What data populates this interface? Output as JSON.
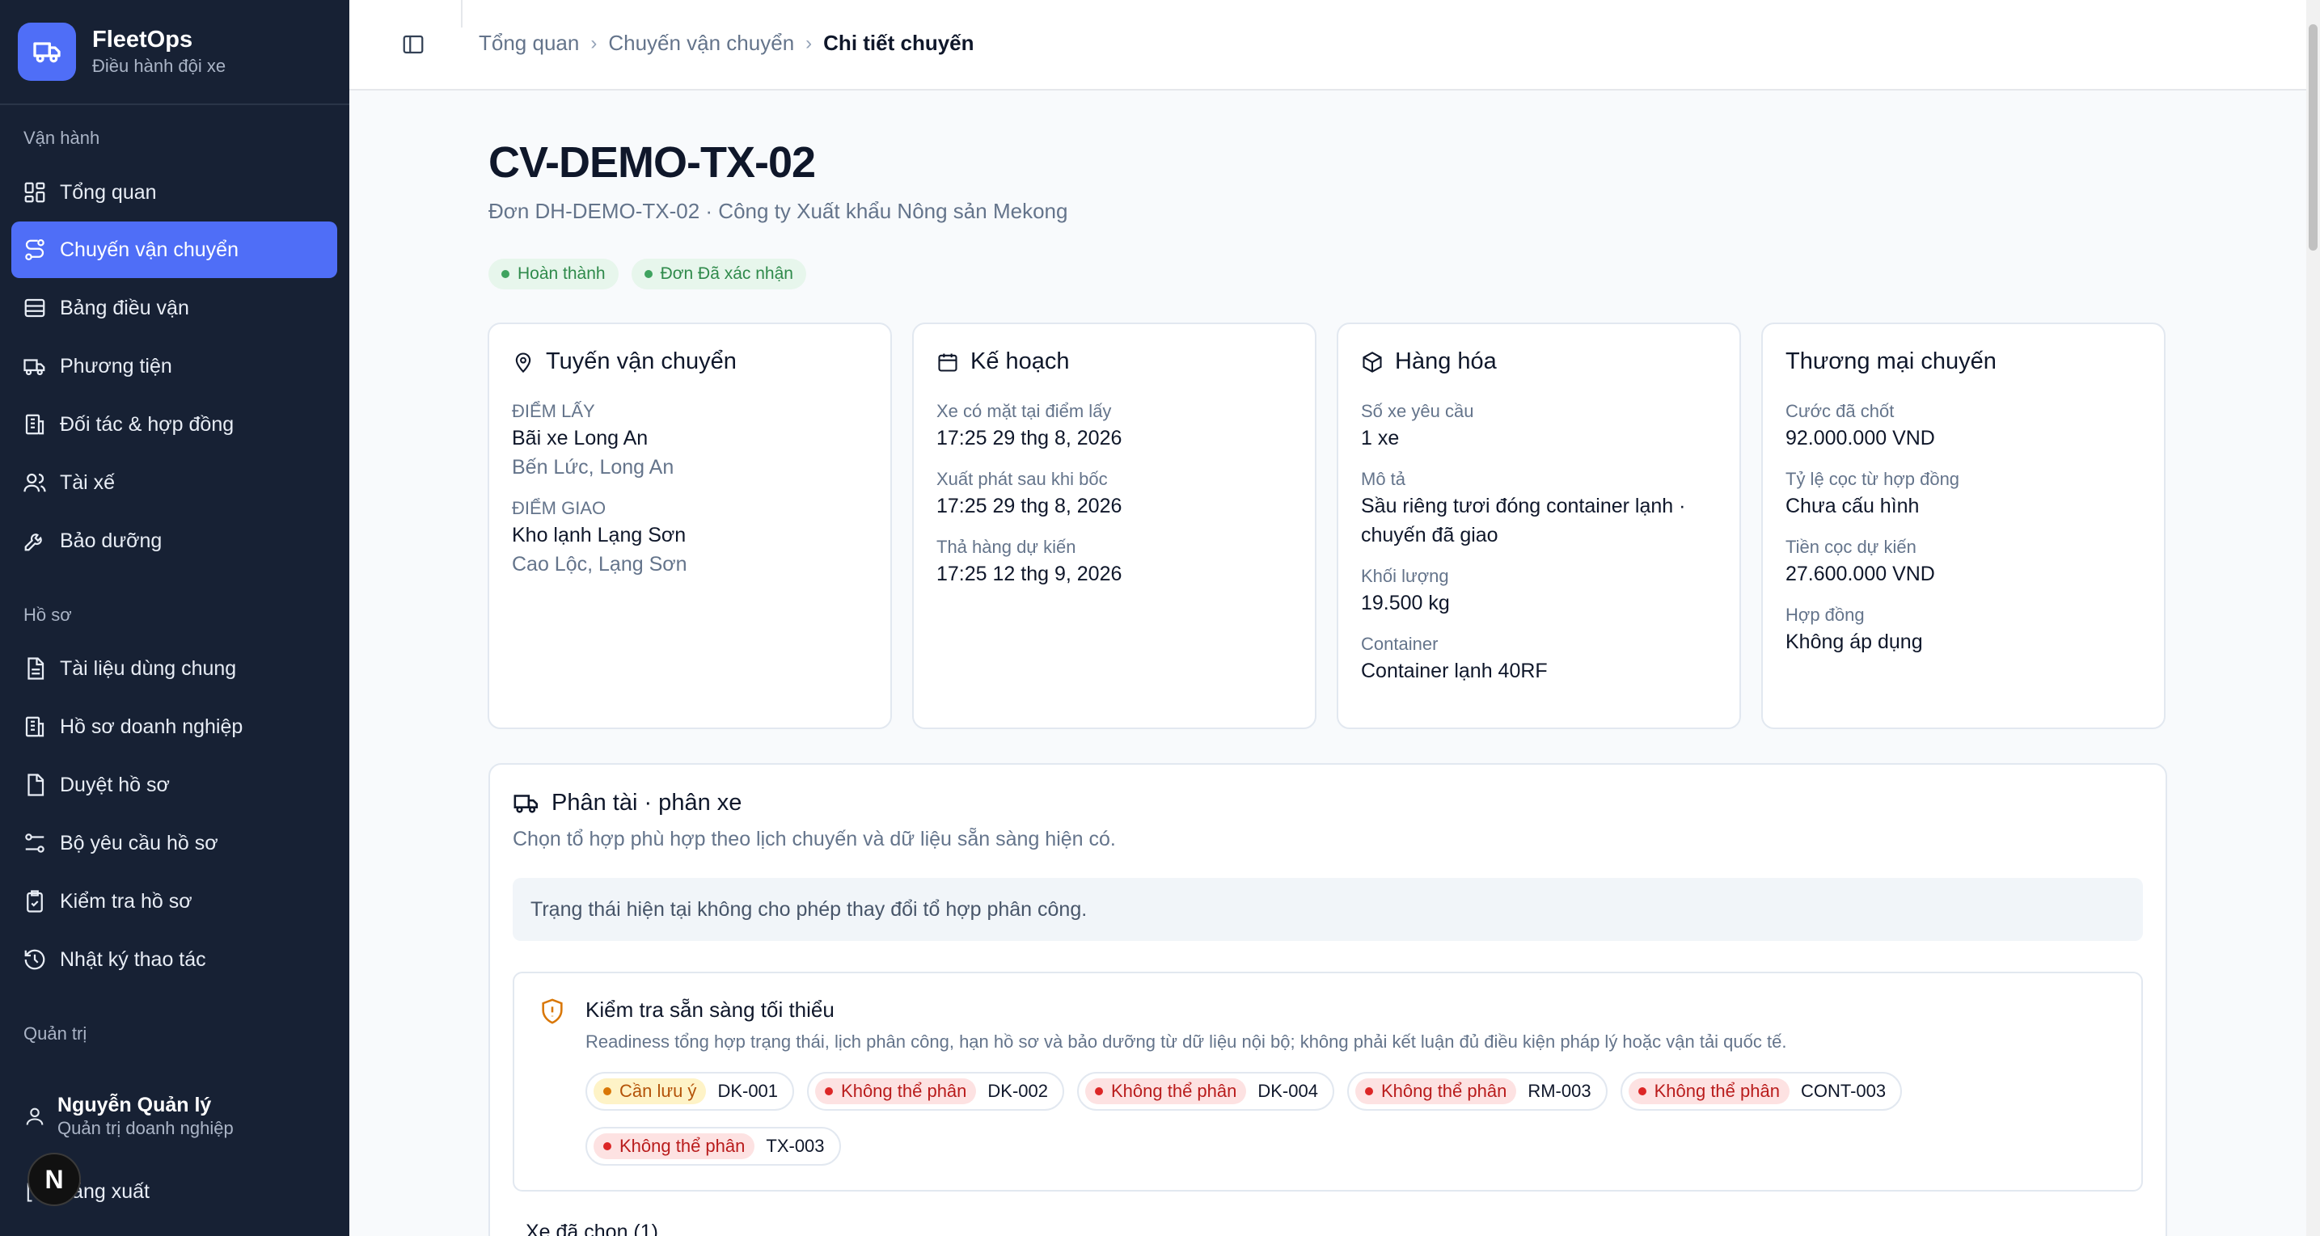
{
  "brand": {
    "title": "FleetOps",
    "subtitle": "Điều hành đội xe"
  },
  "sidebar": {
    "sections": [
      "Vận hành",
      "Hồ sơ",
      "Quản trị"
    ],
    "items": [
      {
        "label": "Tổng quan",
        "icon": "dashboard-icon"
      },
      {
        "label": "Chuyến vận chuyển",
        "icon": "route-icon",
        "active": true
      },
      {
        "label": "Bảng điều vận",
        "icon": "table-icon"
      },
      {
        "label": "Phương tiện",
        "icon": "truck-icon"
      },
      {
        "label": "Đối tác & hợp đồng",
        "icon": "building-icon"
      },
      {
        "label": "Tài xế",
        "icon": "users-icon"
      },
      {
        "label": "Bảo dưỡng",
        "icon": "wrench-icon"
      },
      {
        "label": "Tài liệu dùng chung",
        "icon": "document-icon"
      },
      {
        "label": "Hồ sơ doanh nghiệp",
        "icon": "building-icon"
      },
      {
        "label": "Duyệt hồ sơ",
        "icon": "file-check-icon"
      },
      {
        "label": "Bộ yêu cầu hồ sơ",
        "icon": "sliders-icon"
      },
      {
        "label": "Kiểm tra hồ sơ",
        "icon": "clipboard-check-icon"
      },
      {
        "label": "Nhật ký thao tác",
        "icon": "history-icon"
      }
    ],
    "user": {
      "name": "Nguyễn Quản lý",
      "role": "Quản trị doanh nghiệp"
    },
    "logout": "Đăng xuất",
    "dev_badge": "N"
  },
  "breadcrumb": [
    "Tổng quan",
    "Chuyến vận chuyển",
    "Chi tiết chuyến"
  ],
  "page": {
    "title": "CV-DEMO-TX-02",
    "subtitle": "Đơn DH-DEMO-TX-02 · Công ty Xuất khẩu Nông sản Mekong",
    "badges": [
      "Hoàn thành",
      "Đơn Đã xác nhận"
    ]
  },
  "cards": {
    "route": {
      "title": "Tuyến vận chuyển",
      "pickup_label": "ĐIỂM LẤY",
      "pickup_name": "Bãi xe Long An",
      "pickup_area": "Bến Lức, Long An",
      "drop_label": "ĐIỂM GIAO",
      "drop_name": "Kho lạnh Lạng Sơn",
      "drop_area": "Cao Lộc, Lạng Sơn"
    },
    "plan": {
      "title": "Kế hoạch",
      "fields": [
        {
          "label": "Xe có mặt tại điểm lấy",
          "value": "17:25 29 thg 8, 2026"
        },
        {
          "label": "Xuất phát sau khi bốc",
          "value": "17:25 29 thg 8, 2026"
        },
        {
          "label": "Thả hàng dự kiến",
          "value": "17:25 12 thg 9, 2026"
        }
      ]
    },
    "cargo": {
      "title": "Hàng hóa",
      "fields": [
        {
          "label": "Số xe yêu cầu",
          "value": "1 xe"
        },
        {
          "label": "Mô tả",
          "value": "Sầu riêng tươi đóng container lạnh · chuyến đã giao"
        },
        {
          "label": "Khối lượng",
          "value": "19.500 kg"
        },
        {
          "label": "Container",
          "value": "Container lạnh 40RF"
        }
      ]
    },
    "commerce": {
      "title": "Thương mại chuyến",
      "fields": [
        {
          "label": "Cước đã chốt",
          "value": "92.000.000 VND"
        },
        {
          "label": "Tỷ lệ cọc từ hợp đồng",
          "value": "Chưa cấu hình"
        },
        {
          "label": "Tiền cọc dự kiến",
          "value": "27.600.000 VND"
        },
        {
          "label": "Hợp đồng",
          "value": "Không áp dụng"
        }
      ]
    }
  },
  "assignment": {
    "title": "Phân tài · phân xe",
    "description": "Chọn tổ hợp phù hợp theo lịch chuyến và dữ liệu sẵn sàng hiện có.",
    "notice": "Trạng thái hiện tại không cho phép thay đổi tổ hợp phân công.",
    "check": {
      "title": "Kiểm tra sẵn sàng tối thiểu",
      "description": "Readiness tổng hợp trạng thái, lịch phân công, hạn hồ sơ và bảo dưỡng từ dữ liệu nội bộ; không phải kết luận đủ điều kiện pháp lý hoặc vận tải quốc tế.",
      "chips": [
        {
          "status": "Cần lưu ý",
          "code": "DK-001",
          "level": "warn"
        },
        {
          "status": "Không thể phân",
          "code": "DK-002",
          "level": "bad"
        },
        {
          "status": "Không thể phân",
          "code": "DK-004",
          "level": "bad"
        },
        {
          "status": "Không thể phân",
          "code": "RM-003",
          "level": "bad"
        },
        {
          "status": "Không thể phân",
          "code": "CONT-003",
          "level": "bad"
        },
        {
          "status": "Không thể phân",
          "code": "TX-003",
          "level": "bad"
        }
      ]
    },
    "next_section_partial": "Xe đã chọn (1)"
  },
  "colors": {
    "accent": "#4f6ef7",
    "sidebar": "#172134",
    "success": "#2f8a4b",
    "warn": "#b45309",
    "danger": "#b91c1c"
  }
}
